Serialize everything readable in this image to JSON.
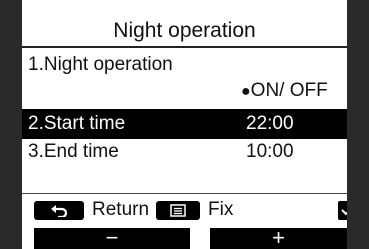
{
  "screen": {
    "title": "Night operation",
    "items": [
      {
        "label": "1.Night operation",
        "value": "ON/ OFF",
        "selected_option": "ON"
      },
      {
        "label": "2.Start time",
        "value": "22:00",
        "selected": true
      },
      {
        "label": "3.End time",
        "value": "10:00"
      }
    ],
    "radio_dot": "●"
  },
  "footer": {
    "return_label": "Return",
    "fix_label": "Fix",
    "return_icon": "return-arrow-icon",
    "fix_icon": "menu-icon",
    "check_icon": "checkmark-icon"
  },
  "buttons": {
    "minus_label": "−",
    "plus_label": "+"
  },
  "colors": {
    "selected_bg": "#000000",
    "selected_fg": "#ffffff",
    "bezel": "#2a2a2a"
  }
}
